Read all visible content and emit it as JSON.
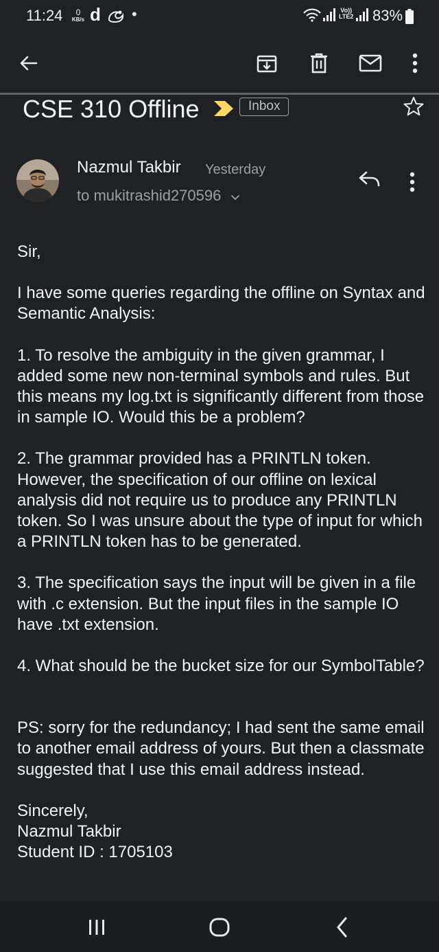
{
  "status_bar": {
    "time": "11:24",
    "net_speed_value": "0",
    "net_speed_unit": "KB/s",
    "carrier_icon_letter": "d",
    "dot": "•",
    "lte_top": "Vo))",
    "lte_bottom": "LTE2",
    "battery_percent": "83%",
    "icons": [
      "wifi-icon",
      "signal-icon",
      "battery-icon",
      "uc-browser-icon"
    ]
  },
  "toolbar": {
    "icons": [
      "back-arrow-icon",
      "archive-icon",
      "delete-icon",
      "mail-icon",
      "more-vert-icon"
    ]
  },
  "message": {
    "subject": "CSE 310 Offline",
    "label": "Inbox",
    "sender_name": "Nazmul Takbir",
    "sent_time": "Yesterday",
    "recipient_line": "to mukitrashid270596",
    "body": {
      "greeting": "Sir,",
      "intro": "I have some queries regarding the offline on Syntax and Semantic Analysis:",
      "q1": "1. To resolve the ambiguity in the given grammar, I added some new non-terminal symbols and rules. But this means my log.txt is significantly different from those in sample IO. Would this be a problem?",
      "q2": "2. The grammar provided has a PRINTLN token. However, the specification of our offline on lexical analysis did not require us to produce any PRINTLN token. So I was unsure about the type of input for which a PRINTLN token has to be generated.",
      "q3": "3. The specification says the input will be given in a file with .c extension. But the input files in the sample IO have .txt extension.",
      "q4": "4. What should be the bucket size for our SymbolTable?",
      "ps": "PS: sorry for the redundancy; I had sent the same email to another email address of yours. But then a classmate suggested that I use this email address instead.",
      "closing": "Sincerely,",
      "signature_name": "Nazmul Takbir",
      "student_id": "Student ID : 1705103"
    }
  },
  "nav_bar": {
    "icons": [
      "recents-icon",
      "home-icon",
      "back-icon"
    ]
  },
  "colors": {
    "background": "#202124",
    "text": "#f1f3f4",
    "secondary_text": "#9aa0a6",
    "importance_marker": "#fdd663"
  }
}
